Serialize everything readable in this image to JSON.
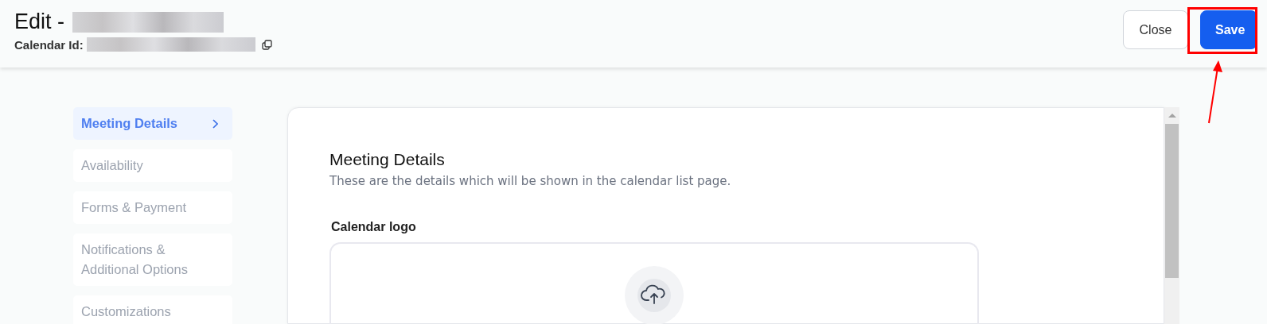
{
  "header": {
    "title": "Edit -",
    "id_label": "Calendar Id:",
    "buttons": [
      {
        "label": "Close",
        "kind": "secondary"
      },
      {
        "label": "Save",
        "kind": "primary"
      }
    ]
  },
  "sidebar": {
    "items": [
      {
        "label": "Meeting Details",
        "selected": true
      },
      {
        "label": "Availability",
        "selected": false
      },
      {
        "label": "Forms & Payment",
        "selected": false
      },
      {
        "label": "Notifications & Additional Options",
        "selected": false
      },
      {
        "label": "Customizations",
        "selected": false
      }
    ]
  },
  "panel": {
    "title": "Meeting Details",
    "subtitle": "These are the details which will be shown in the calendar list page.",
    "logo_label": "Calendar logo"
  }
}
